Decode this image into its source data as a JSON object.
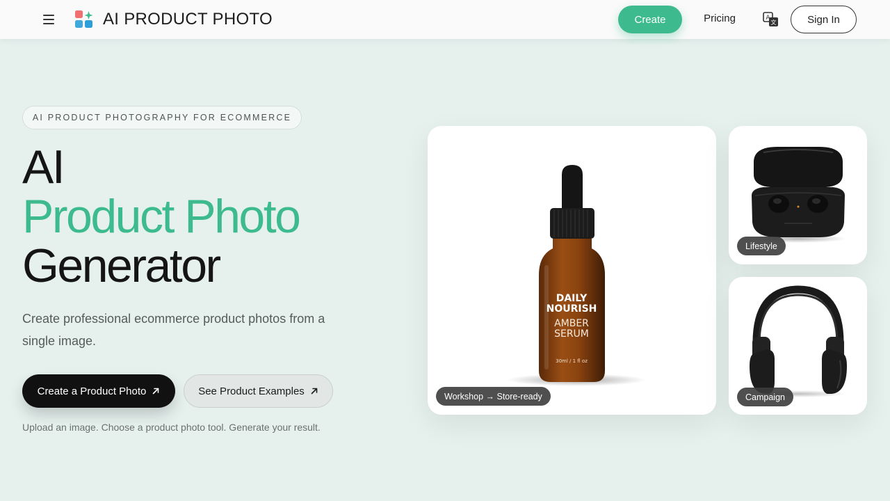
{
  "header": {
    "brand": "AI PRODUCT PHOTO",
    "menu_icon": "hamburger-menu-icon",
    "logo_icon": "app-grid-sparkle-logo",
    "nav": {
      "create_label": "Create",
      "pricing_label": "Pricing",
      "translate_icon": "translate-icon",
      "signin_label": "Sign In"
    }
  },
  "hero": {
    "badge": "AI PRODUCT PHOTOGRAPHY FOR ECOMMERCE",
    "title_line1": "AI",
    "title_line2": "Product Photo",
    "title_line3": "Generator",
    "subtitle": "Create professional ecommerce product photos from a single image.",
    "primary_cta": "Create a Product Photo",
    "secondary_cta": "See Product Examples",
    "cta_icon": "arrow-up-right-icon",
    "helper": "Upload an image. Choose a product photo tool. Generate your result."
  },
  "gallery": {
    "main": {
      "tag": "Workshop → Store-ready",
      "product_brand_line1": "DAILY",
      "product_brand_line2": "NOURISH",
      "product_name_line1": "AMBER",
      "product_name_line2": "SERUM",
      "product_volume": "30ml / 1 fl oz"
    },
    "top": {
      "tag": "Lifestyle"
    },
    "bottom": {
      "tag": "Campaign"
    }
  },
  "colors": {
    "accent": "#3dbb8f",
    "background": "#e6f1ee",
    "dark": "#151515"
  }
}
